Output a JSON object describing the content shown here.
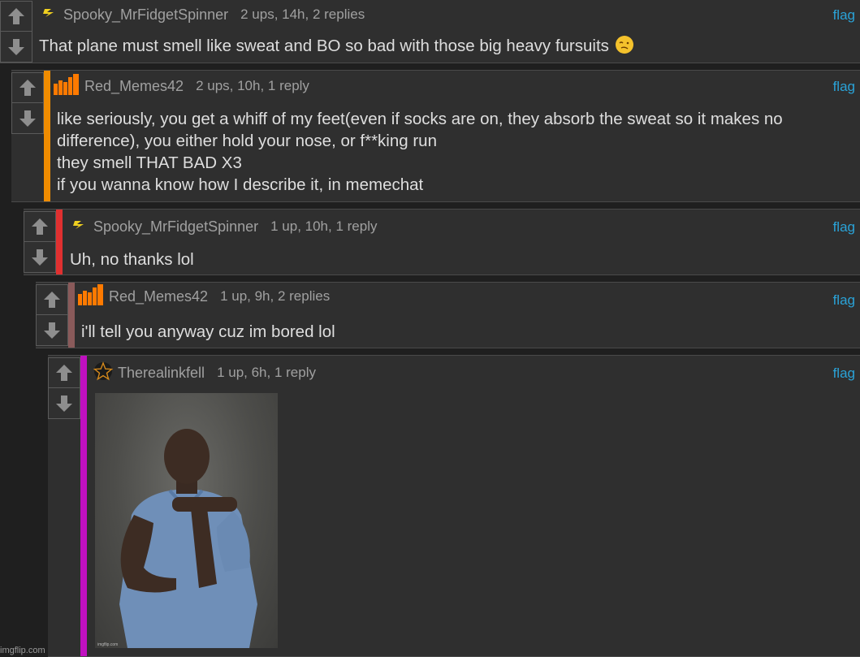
{
  "comments": [
    {
      "username": "Spooky_MrFidgetSpinner",
      "meta": "2 ups, 14h, 2 replies",
      "flag": "flag",
      "badge": "lightning-icon",
      "lines": [
        "That plane must smell like sweat and BO so bad with those big heavy fursuits"
      ],
      "emoji": "woozy-face-emoji"
    },
    {
      "username": "Red_Memes42",
      "meta": "2 ups, 10h, 1 reply",
      "flag": "flag",
      "badge": "bar-chart-icon",
      "indent_color": "#f08c00",
      "lines": [
        "like seriously, you get a whiff of my feet(even if socks are on, they absorb the sweat so it makes no",
        "difference), you either hold your nose, or f**king run",
        "they smell THAT BAD X3",
        "if you wanna know how I describe it, in memechat"
      ]
    },
    {
      "username": "Spooky_MrFidgetSpinner",
      "meta": "1 up, 10h, 1 reply",
      "flag": "flag",
      "badge": "lightning-icon",
      "indent_color": "#e03030",
      "lines": [
        "Uh, no thanks lol"
      ]
    },
    {
      "username": "Red_Memes42",
      "meta": "1 up, 9h, 2 replies",
      "flag": "flag",
      "badge": "bar-chart-icon",
      "indent_color": "#8a5a5a",
      "lines": [
        "i'll tell you anyway cuz im bored lol"
      ]
    },
    {
      "username": "Therealinkfell",
      "meta": "1 up, 6h, 1 reply",
      "flag": "flag",
      "badge": "pentagram-star-icon",
      "indent_color": "#c010c0",
      "image": "photo-meme",
      "image_watermark": "imgflip.com"
    }
  ],
  "colors": {
    "background": "#1f1f1f",
    "comment_bg": "#2f2f2f",
    "flag_link": "#2aa3d8",
    "badge_orange": "#ff7a00",
    "badge_yellow": "#f0d020"
  },
  "watermark": "imgflip.com"
}
